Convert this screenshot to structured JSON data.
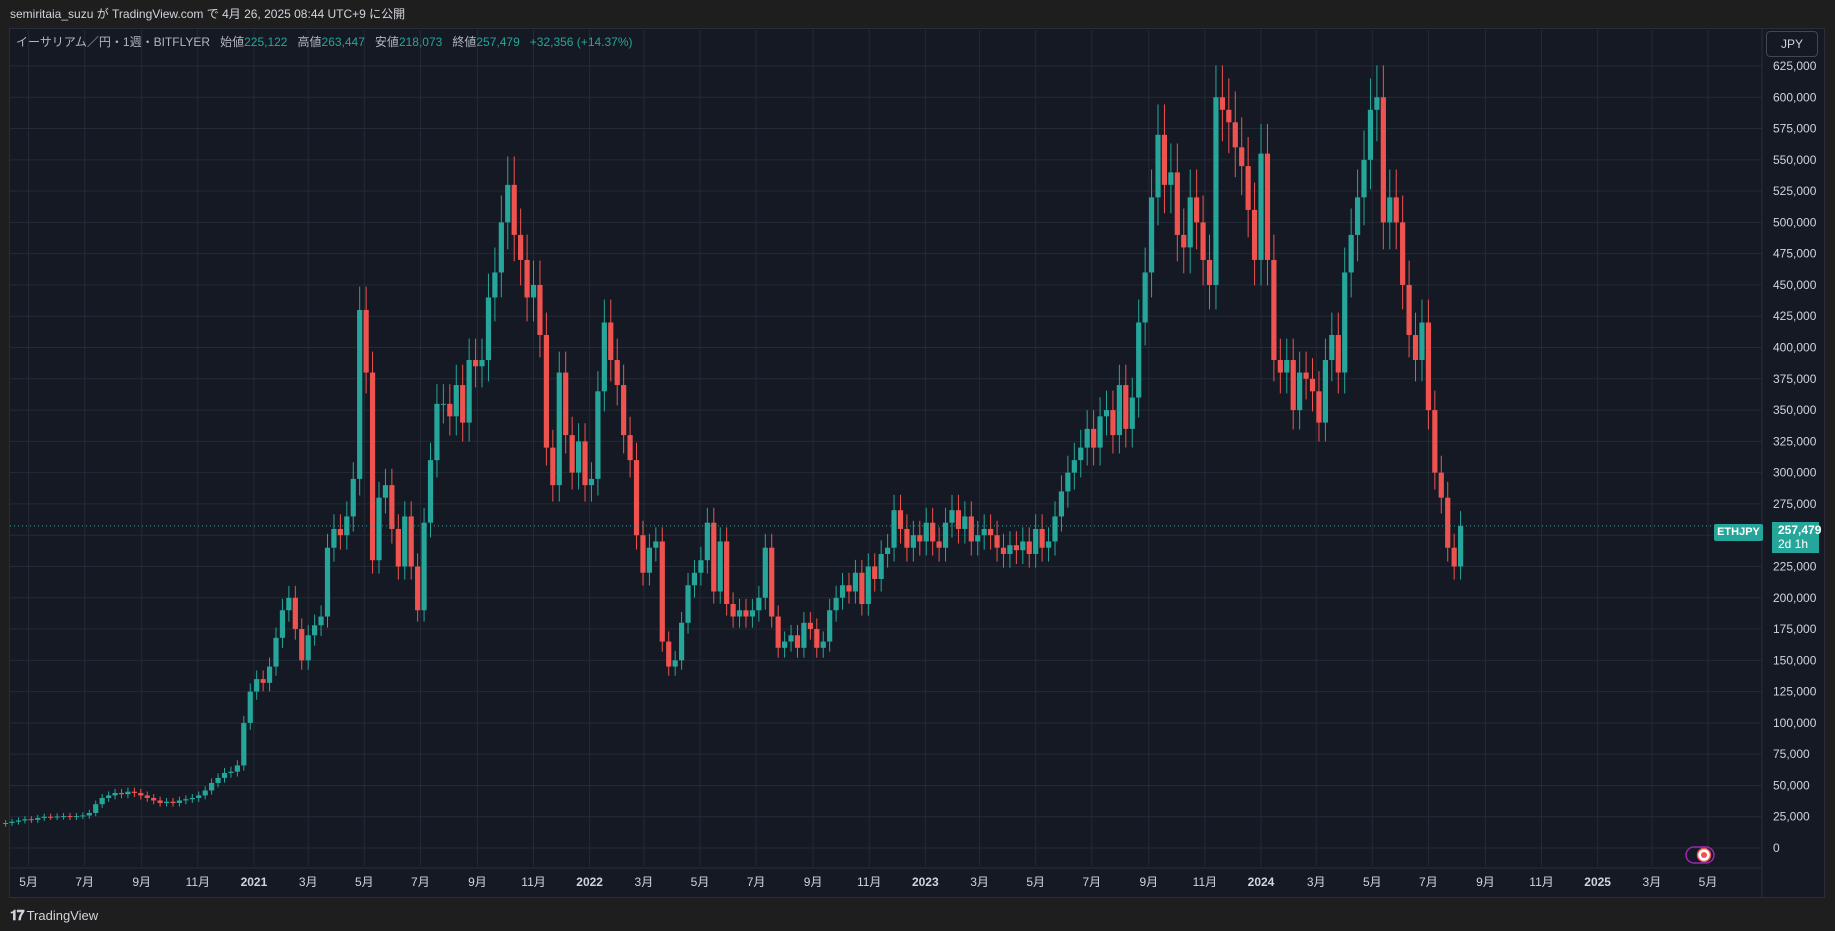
{
  "header": {
    "publish_line": "semiritaia_suzu が TradingView.com で 4月 26, 2025 08:44 UTC+9 に公開"
  },
  "legend": {
    "symbol_line": "イーサリアム／円・1週・BITFLYER",
    "open_label": "始値",
    "open_value": "225,122",
    "high_label": "高値",
    "high_value": "263,447",
    "low_label": "安値",
    "low_value": "218,073",
    "close_label": "終値",
    "close_value": "257,479",
    "change": "+32,356 (+14.37%)"
  },
  "currency_button": "JPY",
  "price_tag": {
    "symbol": "ETHJPY",
    "price": "257,479",
    "countdown": "2d 1h"
  },
  "brand": {
    "logo": "𝟏𝟕",
    "name": "TradingView"
  },
  "colors": {
    "up": "#26a69a",
    "down": "#ef5350",
    "background": "#141923",
    "grid": "#242a36",
    "text": "#d1d4dc"
  },
  "chart_data": {
    "type": "candlestick",
    "interval": "1 week",
    "symbol": "ETHJPY",
    "exchange": "BITFLYER",
    "ylim": [
      0,
      625000
    ],
    "y_ticks": [
      "0",
      "25,000",
      "50,000",
      "75,000",
      "100,000",
      "125,000",
      "150,000",
      "175,000",
      "200,000",
      "225,000",
      "250,000",
      "275,000",
      "300,000",
      "325,000",
      "350,000",
      "375,000",
      "400,000",
      "425,000",
      "450,000",
      "475,000",
      "500,000",
      "525,000",
      "550,000",
      "575,000",
      "600,000",
      "625,000"
    ],
    "x_ticks": [
      {
        "label": "5月",
        "date": "2020-05-01",
        "major": false
      },
      {
        "label": "7月",
        "date": "2020-07-01",
        "major": false
      },
      {
        "label": "9月",
        "date": "2020-09-01",
        "major": false
      },
      {
        "label": "11月",
        "date": "2020-11-01",
        "major": false
      },
      {
        "label": "2021",
        "date": "2021-01-01",
        "major": true
      },
      {
        "label": "3月",
        "date": "2021-03-01",
        "major": false
      },
      {
        "label": "5月",
        "date": "2021-05-01",
        "major": false
      },
      {
        "label": "7月",
        "date": "2021-07-01",
        "major": false
      },
      {
        "label": "9月",
        "date": "2021-09-01",
        "major": false
      },
      {
        "label": "11月",
        "date": "2021-11-01",
        "major": false
      },
      {
        "label": "2022",
        "date": "2022-01-01",
        "major": true
      },
      {
        "label": "3月",
        "date": "2022-03-01",
        "major": false
      },
      {
        "label": "5月",
        "date": "2022-05-01",
        "major": false
      },
      {
        "label": "7月",
        "date": "2022-07-01",
        "major": false
      },
      {
        "label": "9月",
        "date": "2022-09-01",
        "major": false
      },
      {
        "label": "11月",
        "date": "2022-11-01",
        "major": false
      },
      {
        "label": "2023",
        "date": "2023-01-01",
        "major": true
      },
      {
        "label": "3月",
        "date": "2023-03-01",
        "major": false
      },
      {
        "label": "5月",
        "date": "2023-05-01",
        "major": false
      },
      {
        "label": "7月",
        "date": "2023-07-01",
        "major": false
      },
      {
        "label": "9月",
        "date": "2023-09-01",
        "major": false
      },
      {
        "label": "11月",
        "date": "2023-11-01",
        "major": false
      },
      {
        "label": "2024",
        "date": "2024-01-01",
        "major": true
      },
      {
        "label": "3月",
        "date": "2024-03-01",
        "major": false
      },
      {
        "label": "5月",
        "date": "2024-05-01",
        "major": false
      },
      {
        "label": "7月",
        "date": "2024-07-01",
        "major": false
      },
      {
        "label": "9月",
        "date": "2024-09-01",
        "major": false
      },
      {
        "label": "11月",
        "date": "2024-11-01",
        "major": false
      },
      {
        "label": "2025",
        "date": "2025-01-01",
        "major": true
      },
      {
        "label": "3月",
        "date": "2025-03-01",
        "major": false
      },
      {
        "label": "5月",
        "date": "2025-05-01",
        "major": false
      }
    ],
    "weekly_close": [
      20000,
      21000,
      22000,
      23000,
      22500,
      24000,
      25000,
      24800,
      25200,
      25500,
      24800,
      25500,
      26000,
      28000,
      35000,
      40000,
      42000,
      44000,
      43000,
      45000,
      44000,
      42000,
      40000,
      38000,
      36000,
      37000,
      36000,
      38000,
      39000,
      40000,
      42000,
      46000,
      52000,
      56000,
      60000,
      61000,
      66000,
      100000,
      125000,
      135000,
      132000,
      145000,
      168000,
      190000,
      200000,
      175000,
      150000,
      170000,
      178000,
      185000,
      240000,
      255000,
      250000,
      265000,
      295000,
      430000,
      380000,
      230000,
      280000,
      290000,
      255000,
      225000,
      265000,
      225000,
      190000,
      260000,
      310000,
      355000,
      355000,
      345000,
      370000,
      340000,
      390000,
      385000,
      390000,
      440000,
      460000,
      500000,
      530000,
      490000,
      470000,
      440000,
      450000,
      410000,
      320000,
      290000,
      380000,
      330000,
      300000,
      325000,
      290000,
      295000,
      365000,
      420000,
      390000,
      370000,
      330000,
      310000,
      250000,
      220000,
      240000,
      245000,
      165000,
      145000,
      150000,
      180000,
      210000,
      220000,
      230000,
      260000,
      205000,
      245000,
      195000,
      185000,
      190000,
      185000,
      190000,
      200000,
      240000,
      185000,
      160000,
      165000,
      170000,
      160000,
      180000,
      175000,
      160000,
      165000,
      190000,
      200000,
      210000,
      205000,
      220000,
      195000,
      225000,
      215000,
      235000,
      240000,
      270000,
      255000,
      240000,
      250000,
      245000,
      260000,
      245000,
      240000,
      260000,
      270000,
      255000,
      265000,
      245000,
      250000,
      255000,
      250000,
      240000,
      235000,
      242000,
      238000,
      245000,
      235000,
      255000,
      240000,
      245000,
      265000,
      285000,
      300000,
      310000,
      320000,
      335000,
      320000,
      345000,
      350000,
      330000,
      370000,
      335000,
      360000,
      420000,
      460000,
      520000,
      570000,
      530000,
      540000,
      490000,
      480000,
      520000,
      500000,
      470000,
      450000,
      600000,
      590000,
      580000,
      560000,
      545000,
      510000,
      470000,
      555000,
      470000,
      390000,
      380000,
      390000,
      350000,
      380000,
      375000,
      365000,
      340000,
      390000,
      410000,
      380000,
      460000,
      490000,
      520000,
      550000,
      590000,
      600000,
      500000,
      520000,
      500000,
      450000,
      410000,
      390000,
      420000,
      350000,
      300000,
      280000,
      240000,
      225000,
      257479
    ]
  }
}
